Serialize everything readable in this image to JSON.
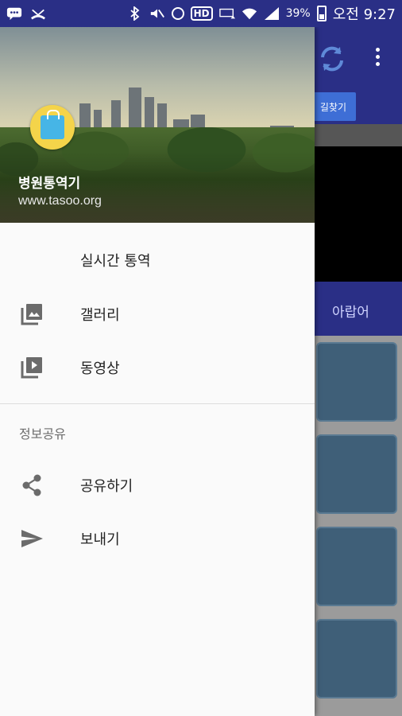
{
  "status_bar": {
    "battery_percent": "39%",
    "time": "오전 9:27",
    "icons": [
      "messenger-icon",
      "missed-call-icon",
      "bluetooth-icon",
      "mute-icon",
      "alarm-icon",
      "hd-icon",
      "lte-icon",
      "wifi-icon",
      "signal-icon",
      "battery-icon"
    ]
  },
  "background_app": {
    "find_button": "길찾기",
    "tab_label": "아랍어"
  },
  "drawer": {
    "header": {
      "app_name": "병원통역기",
      "url": "www.tasoo.org"
    },
    "items": [
      {
        "label": "실시간 통역",
        "icon": ""
      },
      {
        "label": "갤러리",
        "icon": "gallery-icon"
      },
      {
        "label": "동영상",
        "icon": "video-icon"
      }
    ],
    "section_title": "정보공유",
    "share_items": [
      {
        "label": "공유하기",
        "icon": "share-icon"
      },
      {
        "label": "보내기",
        "icon": "send-icon"
      }
    ]
  },
  "colors": {
    "primary": "#2a2f86",
    "drawer_bg": "#fafafa",
    "icon_gray": "#6b6b6b"
  }
}
